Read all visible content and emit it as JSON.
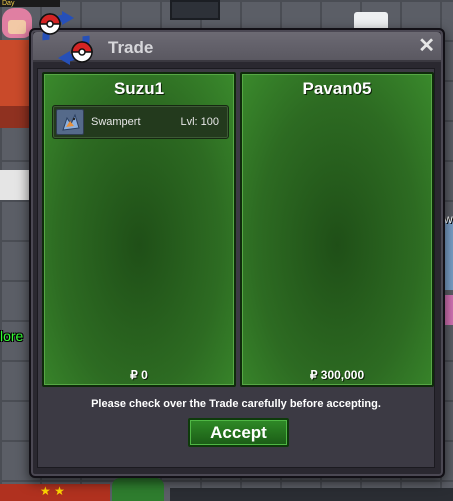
{
  "background": {
    "player_tag": "Day",
    "side_link_text": "lore",
    "side_letter": "w"
  },
  "window": {
    "title": "Trade",
    "close_symbol": "✕"
  },
  "trade": {
    "left": {
      "player": "Suzu1",
      "pokemon": [
        {
          "name": "Swampert",
          "level": "Lvl: 100",
          "icon": "swampert-sprite-icon"
        }
      ],
      "money": "₽ 0"
    },
    "right": {
      "player": "Pavan05",
      "pokemon": [],
      "money": "₽ 300,000"
    },
    "notice": "Please check over the Trade carefully before accepting.",
    "accept_label": "Accept"
  },
  "colors": {
    "panel_green": "#2d6b22",
    "accept_green": "#2f8a27",
    "window_bg": "#2a2830",
    "titlebar": "#5a5861"
  }
}
